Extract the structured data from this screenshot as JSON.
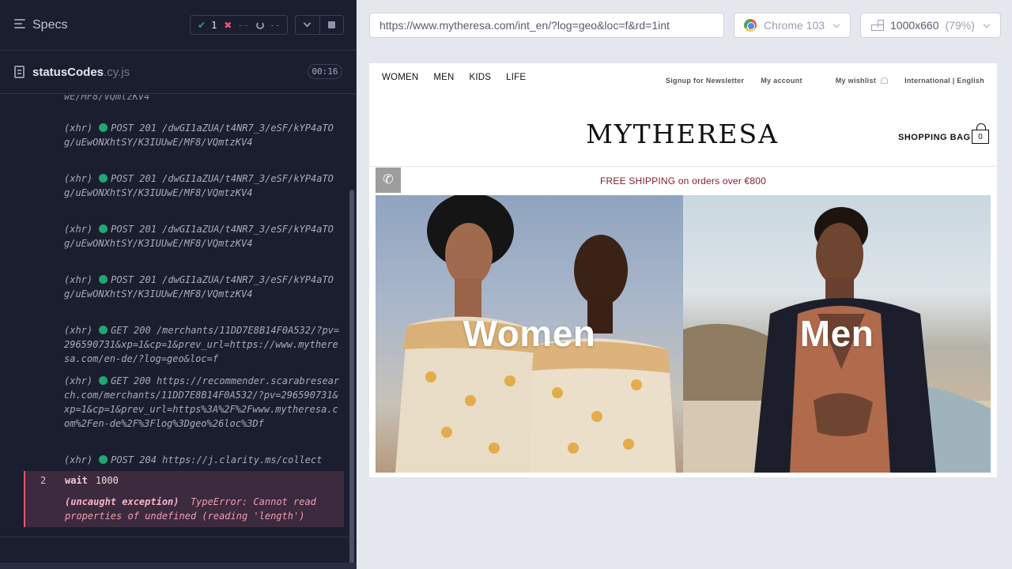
{
  "reporter": {
    "specs_label": "Specs",
    "stats": {
      "passed": "1",
      "failed": "--",
      "pending": "--"
    },
    "file": {
      "name": "statusCodes",
      "ext": ".cy.js"
    },
    "duration": "00:16",
    "partial_line": "wE/MF8/VQmtzKV4",
    "commands": [
      {
        "type": "(xhr)",
        "method": "POST 201",
        "url": "/dwGI1aZUA/t4NR7_3/eSF/kYP4aTOg/uEwONXhtSY/K3IUUwE/MF8/VQmtzKV4"
      },
      {
        "type": "(xhr)",
        "method": "POST 201",
        "url": "/dwGI1aZUA/t4NR7_3/eSF/kYP4aTOg/uEwONXhtSY/K3IUUwE/MF8/VQmtzKV4"
      },
      {
        "type": "(xhr)",
        "method": "POST 201",
        "url": "/dwGI1aZUA/t4NR7_3/eSF/kYP4aTOg/uEwONXhtSY/K3IUUwE/MF8/VQmtzKV4"
      },
      {
        "type": "(xhr)",
        "method": "POST 201",
        "url": "/dwGI1aZUA/t4NR7_3/eSF/kYP4aTOg/uEwONXhtSY/K3IUUwE/MF8/VQmtzKV4"
      },
      {
        "type": "(xhr)",
        "method": "GET 200",
        "url": "/merchants/11DD7E8B14F0A532/?pv=296590731&xp=1&cp=1&prev_url=https://www.mytheresa.com/en-de/?log=geo&loc=f"
      },
      {
        "type": "(xhr)",
        "method": "GET 200",
        "url": "https://recommender.scarabresearch.com/merchants/11DD7E8B14F0A532/?pv=296590731&xp=1&cp=1&prev_url=https%3A%2F%2Fwww.mytheresa.com%2Fen-de%2F%3Flog%3Dgeo%26loc%3Df"
      },
      {
        "type": "(xhr)",
        "method": "POST 204",
        "url": "https://j.clarity.ms/collect"
      }
    ],
    "error": {
      "number": "2",
      "command": "wait",
      "arg": "1000",
      "label": "(uncaught exception)",
      "message": "TypeError: Cannot read properties of undefined (reading 'length')"
    }
  },
  "aut": {
    "url": "https://www.mytheresa.com/int_en/?log=geo&loc=f&rd=1int",
    "browser": "Chrome 103",
    "viewport": "1000x660",
    "scale": "(79%)"
  },
  "site": {
    "nav": [
      "WOMEN",
      "MEN",
      "KIDS",
      "LIFE"
    ],
    "utils": {
      "newsletter": "Signup for Newsletter",
      "account": "My account",
      "wishlist": "My wishlist",
      "locale": "International | English"
    },
    "logo": "MYTHERESA",
    "bag_label": "SHOPPING BAG",
    "bag_count": "0",
    "banner": "FREE SHIPPING on orders over €800",
    "hero_women": "Women",
    "hero_men": "Men"
  }
}
